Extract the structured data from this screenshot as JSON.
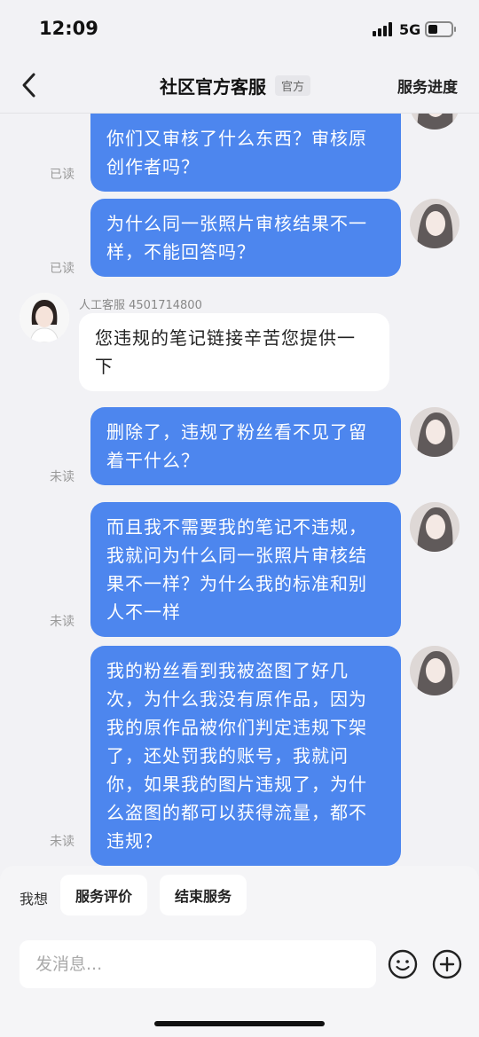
{
  "status_bar": {
    "time": "12:09",
    "network": "5G"
  },
  "nav": {
    "title": "社区官方客服",
    "badge": "官方",
    "right_link": "服务进度"
  },
  "messages": [
    {
      "text": "你们又审核了什么东西？审核原创作者吗？",
      "status": "已读"
    },
    {
      "text": "为什么同一张照片审核结果不一样，不能回答吗？",
      "status": "已读"
    },
    {
      "agent_label": "人工客服 4501714800",
      "text": "您违规的笔记链接辛苦您提供一下"
    },
    {
      "text": "删除了，违规了粉丝看不见了留着干什么？",
      "status": "未读"
    },
    {
      "text": "而且我不需要我的笔记不违规，我就问为什么同一张照片审核结果不一样？为什么我的标准和别人不一样",
      "status": "未读"
    },
    {
      "text": "我的粉丝看到我被盗图了好几次，为什么我没有原作品，因为我的原作品被你们判定违规下架了，还处罚我的账号，我就问你，如果我的图片违规了，为什么盗图的都可以获得流量，都不违规？",
      "status": "未读"
    }
  ],
  "quick_actions": {
    "label": "我想",
    "items": [
      "服务评价",
      "结束服务"
    ]
  },
  "composer": {
    "placeholder": "发消息..."
  },
  "icons": [
    "back-icon",
    "emoji-icon",
    "plus-icon"
  ],
  "colors": {
    "outgoing_bubble": "#4d86ee",
    "incoming_bubble": "#ffffff",
    "background": "#f2f2f5"
  }
}
